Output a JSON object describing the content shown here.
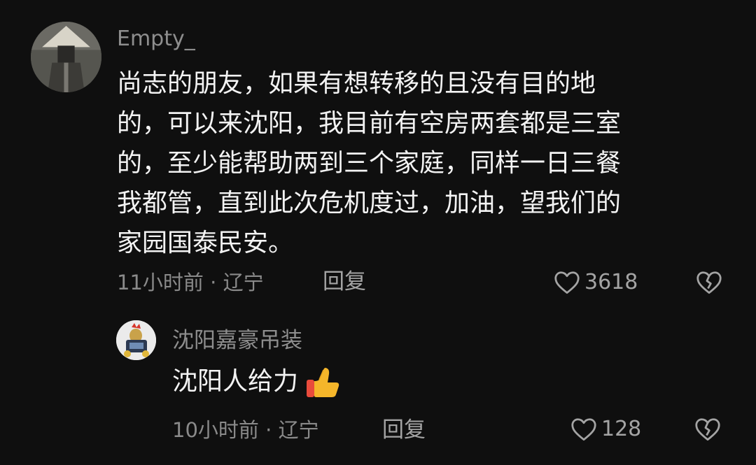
{
  "comments": [
    {
      "username": "Empty_",
      "lines": [
        "尚志的朋友，如果有想转移的且没有目的地",
        "的，可以来沈阳，我目前有空房两套都是三室",
        "的，至少能帮助两到三个家庭，同样一日三餐",
        "我都管，直到此次危机度过，加油，望我们的",
        "家园国泰民安。"
      ],
      "time": "11小时前",
      "location": "辽宁",
      "reply_label": "回复",
      "likes": "3618"
    },
    {
      "username": "沈阳嘉豪吊装",
      "text": "沈阳人给力",
      "emoji_icon": "thumbs-up-icon",
      "time": "10小时前",
      "location": "辽宁",
      "reply_label": "回复",
      "likes": "128"
    }
  ],
  "meta_separator": "·",
  "colors": {
    "background": "#0f0f0f",
    "text": "#f3f3f3",
    "muted": "#8e8e8e",
    "thumbs_up": "#f5b62a"
  }
}
